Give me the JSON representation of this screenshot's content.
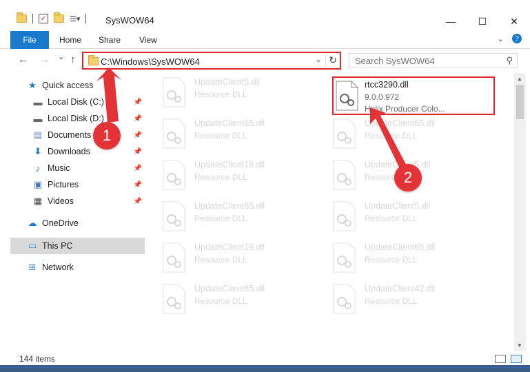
{
  "window": {
    "title": "SysWOW64",
    "controls": {
      "minimize": "—",
      "maximize": "☐",
      "close": "✕"
    }
  },
  "ribbon": {
    "tabs": [
      "File",
      "Home",
      "Share",
      "View"
    ],
    "expand_icon": "chevron-down-icon",
    "help": "?"
  },
  "navigation": {
    "back": "←",
    "forward": "→",
    "recent": "⌄",
    "up": "↑",
    "address": "C:\\Windows\\SysWOW64",
    "refresh": "↻",
    "dropdown": "⌄",
    "search_placeholder": "Search SysWOW64"
  },
  "sidebar": {
    "items": [
      {
        "label": "Quick access",
        "icon": "star-icon"
      },
      {
        "label": "Local Disk (C:)",
        "icon": "drive-icon",
        "pinned": true
      },
      {
        "label": "Local Disk (D:)",
        "icon": "drive-icon",
        "pinned": true
      },
      {
        "label": "Documents",
        "icon": "documents-icon",
        "pinned": true
      },
      {
        "label": "Downloads",
        "icon": "downloads-icon",
        "pinned": true
      },
      {
        "label": "Music",
        "icon": "music-icon",
        "pinned": true
      },
      {
        "label": "Pictures",
        "icon": "pictures-icon",
        "pinned": true
      },
      {
        "label": "Videos",
        "icon": "videos-icon",
        "pinned": true
      },
      {
        "label": "OneDrive",
        "icon": "onedrive-icon"
      },
      {
        "label": "This PC",
        "icon": "pc-icon",
        "selected": true
      },
      {
        "label": "Network",
        "icon": "network-icon"
      }
    ]
  },
  "files": {
    "left_column": [
      {
        "name": "UpdateClient5.dll",
        "type": "Resource DLL"
      },
      {
        "name": "UpdateClient65.dll",
        "type": "Resource DLL"
      },
      {
        "name": "UpdateClient19.dll",
        "type": "Resource DLL"
      },
      {
        "name": "UpdateClient65.dll",
        "type": "Resource DLL"
      },
      {
        "name": "UpdateClient19.dll",
        "type": "Resource DLL"
      },
      {
        "name": "UpdateClient65.dll",
        "type": "Resource DLL"
      }
    ],
    "right_column": [
      {
        "name": "UpdateClient65.dll",
        "type": "Resource DLL"
      },
      {
        "name": "UpdateClient5.dll",
        "type": "Resource DLL"
      },
      {
        "name": "UpdateClient5.dll",
        "type": "Resource DLL"
      },
      {
        "name": "UpdateClient65.dll",
        "type": "Resource DLL"
      },
      {
        "name": "UpdateClient42.dll",
        "type": "Resource DLL"
      }
    ],
    "highlighted": {
      "name": "rtcc3290.dll",
      "version": "9.0.0.972",
      "description": "Helix Producer Colo..."
    }
  },
  "status": {
    "item_count": "144 items"
  },
  "markers": [
    "1",
    "2"
  ],
  "colors": {
    "accent": "#1979ca",
    "highlight": "#e0272a",
    "marker": "#e43336"
  }
}
